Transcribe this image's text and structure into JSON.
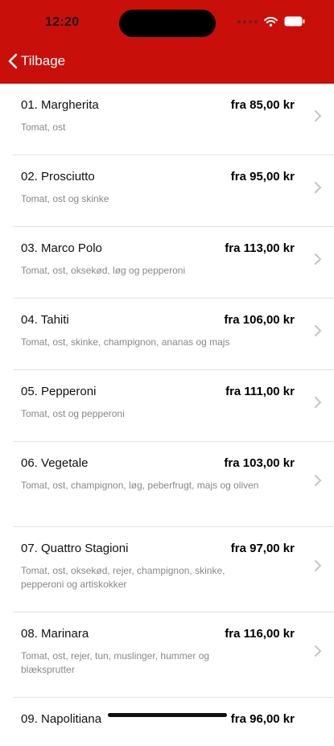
{
  "status_bar": {
    "time": "12:20"
  },
  "nav": {
    "back_label": "Tilbage"
  },
  "items": [
    {
      "name": "01. Margherita",
      "price": "fra 85,00 kr",
      "desc": "Tomat, ost"
    },
    {
      "name": "02. Prosciutto",
      "price": "fra 95,00 kr",
      "desc": "Tomat, ost og skinke"
    },
    {
      "name": "03. Marco Polo",
      "price": "fra 113,00 kr",
      "desc": "Tomat, ost, oksekød, løg og pepperoni"
    },
    {
      "name": "04. Tahiti",
      "price": "fra 106,00 kr",
      "desc": "Tomat, ost, skinke, champignon, ananas og majs"
    },
    {
      "name": "05. Pepperoni",
      "price": "fra 111,00 kr",
      "desc": "Tomat, ost og pepperoni"
    },
    {
      "name": "06. Vegetale",
      "price": "fra 103,00 kr",
      "desc": "Tomat, ost, champignon, løg, peberfrugt, majs og oliven"
    },
    {
      "name": "07. Quattro Stagioni",
      "price": "fra 97,00 kr",
      "desc": "Tomat, ost, oksekød, rejer, champignon, skinke, pepperoni og artiskokker"
    },
    {
      "name": "08. Marinara",
      "price": "fra 116,00 kr",
      "desc": "Tomat, ost, rejer, tun, muslinger, hummer og blæksprutter"
    },
    {
      "name": "09. Napolitiana",
      "price": "fra 96,00 kr",
      "desc": ""
    }
  ]
}
